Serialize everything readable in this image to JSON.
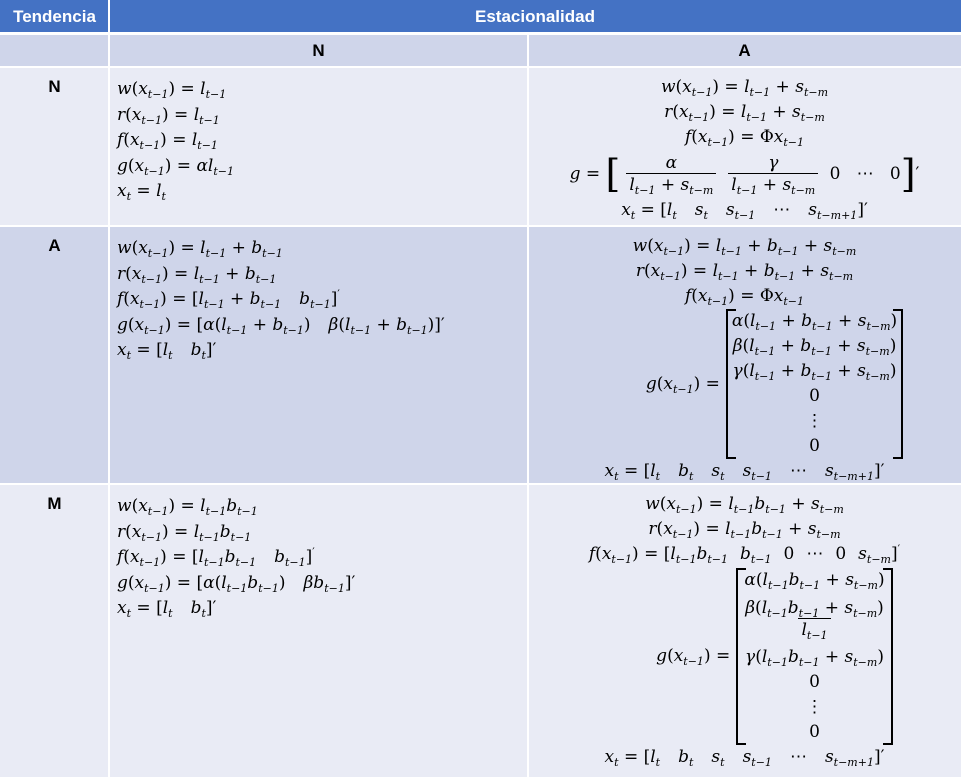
{
  "header": {
    "tendencia": "Tendencia",
    "estacionalidad": "Estacionalidad",
    "col_n": "N",
    "col_a": "A"
  },
  "rows": [
    {
      "label": "N"
    },
    {
      "label": "A"
    },
    {
      "label": "M"
    }
  ],
  "colors": {
    "header_bg": "#4472c4",
    "band_dark": "#cfd5ea",
    "band_light": "#e9ebf5"
  }
}
